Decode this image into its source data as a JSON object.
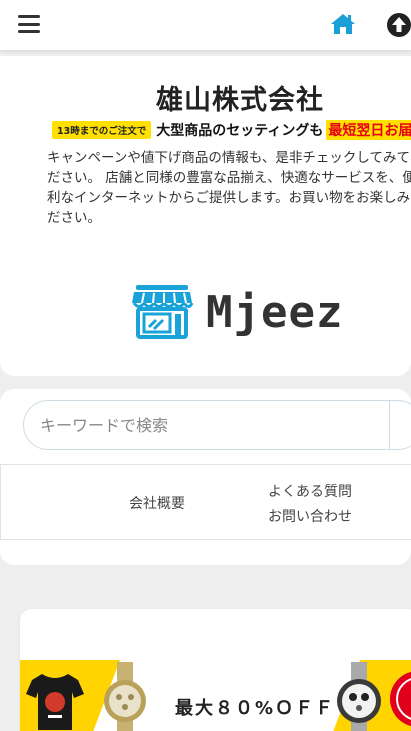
{
  "header": {
    "menu_icon": "hamburger-menu-icon",
    "home_icon": "home-icon",
    "scroll_top_icon": "arrow-up-circle-icon",
    "accent_color": "#1a9fd6"
  },
  "company": {
    "name": "雄山株式会社",
    "promo_tag": "13時までのご注文で",
    "promo_main": "大型商品のセッティングも",
    "promo_highlight": "最短翌日お届け",
    "description": "キャンペーンや値下げ商品の情報も、是非チェックしてみてください。 店舗と同様の豊富な品揃え、快適なサービスを、便利なインターネットからご提供します。お買い物をお楽しみください。",
    "logo_text": "Mjeez",
    "logo_icon": "storefront-icon",
    "logo_color": "#1aa3d8"
  },
  "search": {
    "placeholder": "キーワードで検索"
  },
  "nav": {
    "company_overview": "会社概要",
    "faq": "よくある質問",
    "contact": "お問い合わせ"
  },
  "banner": {
    "text": "最大８０%ＯＦＦ",
    "bg_color": "#ffd400"
  }
}
